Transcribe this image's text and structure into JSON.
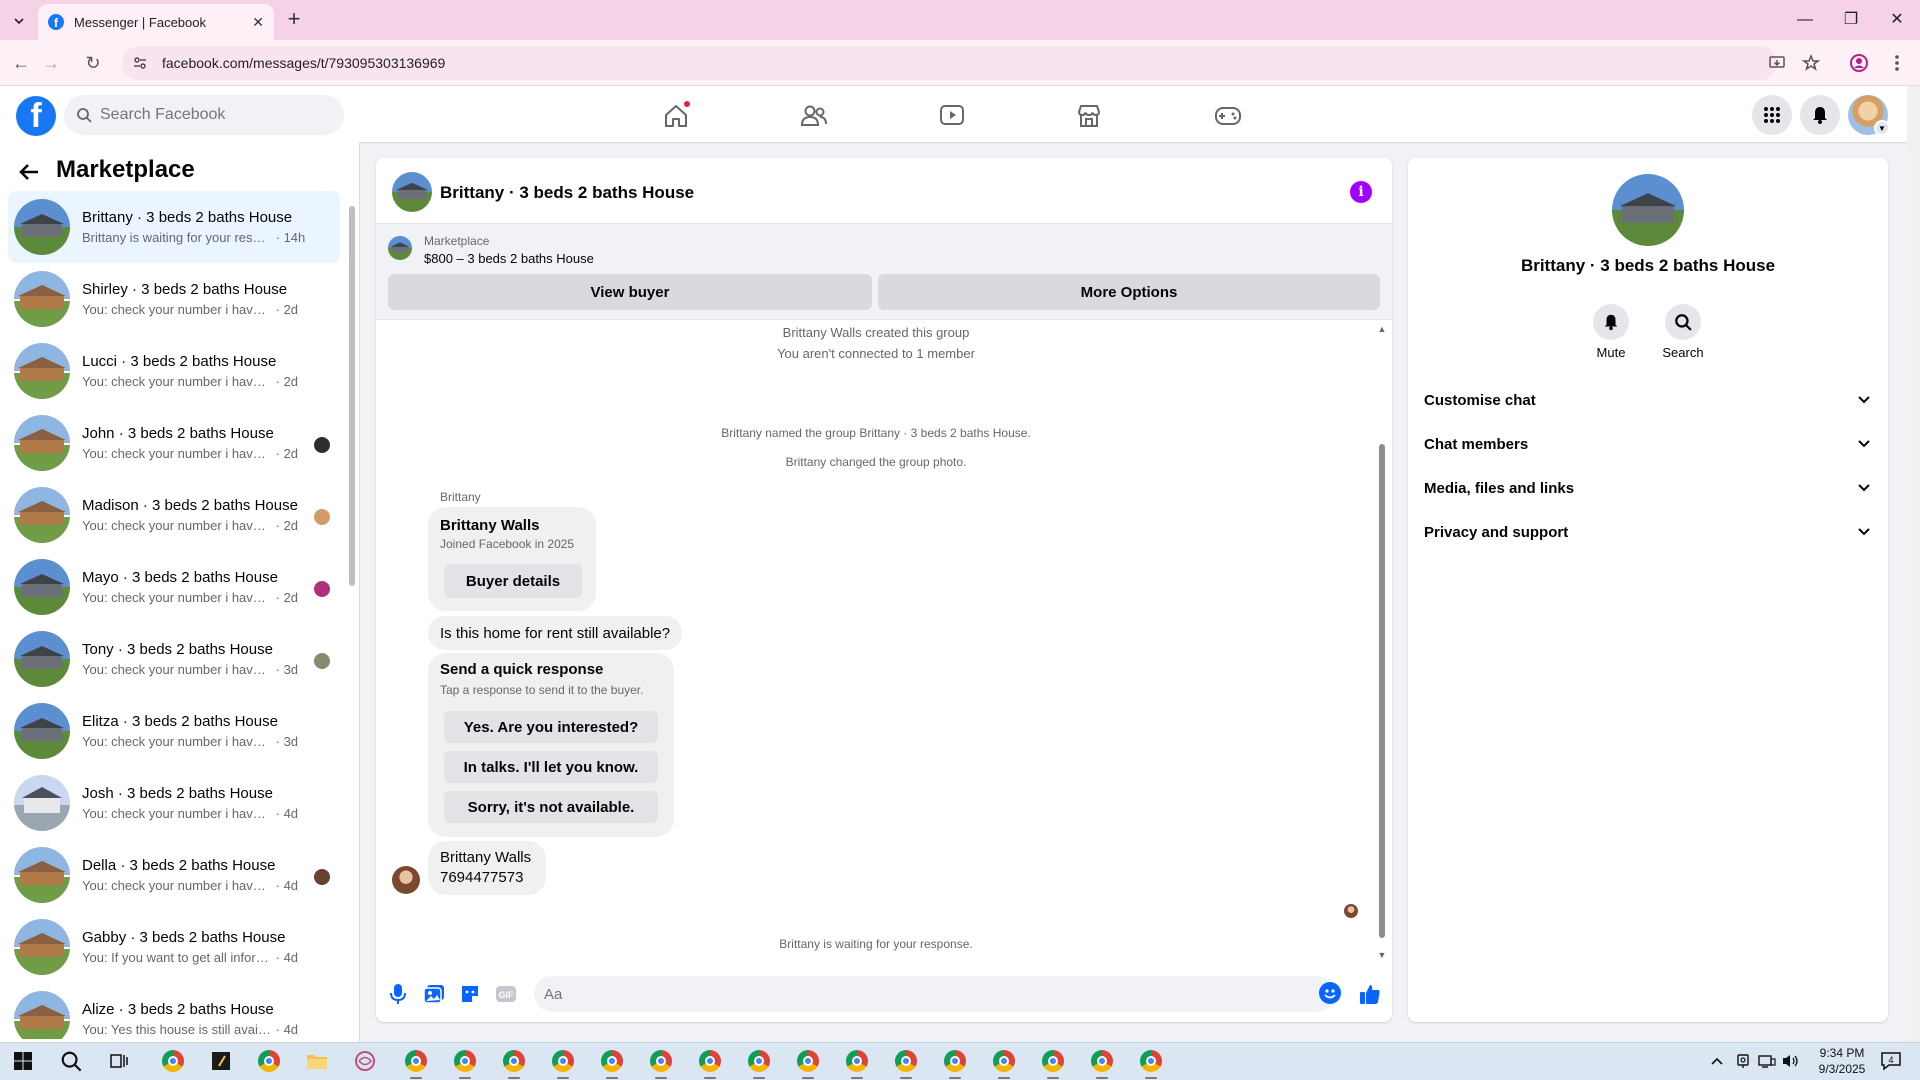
{
  "browser": {
    "tab_title": "Messenger | Facebook",
    "url": "facebook.com/messages/t/793095303136969"
  },
  "fb": {
    "search_placeholder": "Search Facebook"
  },
  "left": {
    "title": "Marketplace",
    "conversations": [
      {
        "name": "Brittany · 3 beds 2 baths House",
        "preview": "Brittany is waiting for your respon...",
        "time": "· 14h",
        "active": true
      },
      {
        "name": "Shirley · 3 beds 2 baths House",
        "preview": "You: check your number i have sen...",
        "time": "· 2d"
      },
      {
        "name": "Lucci · 3 beds 2 baths House",
        "preview": "You: check your number i have sen...",
        "time": "· 2d"
      },
      {
        "name": "John · 3 beds 2 baths House",
        "preview": "You: check your number i have s...",
        "time": "· 2d"
      },
      {
        "name": "Madison · 3 beds 2 baths House",
        "preview": "You: check your number i have s...",
        "time": "· 2d"
      },
      {
        "name": "Mayo · 3 beds 2 baths House",
        "preview": "You: check your number i have s...",
        "time": "· 2d"
      },
      {
        "name": "Tony · 3 beds 2 baths House",
        "preview": "You: check your number i have s...",
        "time": "· 3d"
      },
      {
        "name": "Elitza · 3 beds 2 baths House",
        "preview": "You: check your number i have sen...",
        "time": "· 3d"
      },
      {
        "name": "Josh · 3 beds 2 baths House",
        "preview": "You: check your number i have sen...",
        "time": "· 4d"
      },
      {
        "name": "Della · 3 beds 2 baths House",
        "preview": "You: check your number i have s...",
        "time": "· 4d"
      },
      {
        "name": "Gabby · 3 beds 2 baths House",
        "preview": "You: If you want to get all informati...",
        "time": "· 4d"
      },
      {
        "name": "Alize · 3 beds 2 baths House",
        "preview": "You: Yes this house is still available ...",
        "time": "· 4d"
      }
    ]
  },
  "chat": {
    "title": "Brittany · 3 beds 2 baths House",
    "listing_category": "Marketplace",
    "listing_price": "$800 – 3 beds 2 baths House",
    "view_buyer": "View buyer",
    "more_options": "More Options",
    "sys_created": "Brittany Walls created this group",
    "sys_not_connected": "You aren't connected to 1 member",
    "sys_named": "Brittany named the group Brittany · 3 beds 2 baths House.",
    "sys_photo": "Brittany changed the group photo.",
    "sender_label": "Brittany",
    "buyer_name": "Brittany Walls",
    "buyer_joined": "Joined Facebook in 2025",
    "buyer_details": "Buyer details",
    "question": "Is this home for rent still available?",
    "quick_title": "Send a quick response",
    "quick_sub": "Tap a response to send it to the buyer.",
    "quick_1": "Yes. Are you interested?",
    "quick_2": "In talks. I'll let you know.",
    "quick_3": "Sorry, it's not available.",
    "contact_name": "Brittany Walls",
    "contact_number": "7694477573",
    "waiting": "Brittany is waiting for your response.",
    "input_placeholder": "Aa"
  },
  "right": {
    "title": "Brittany · 3 beds 2 baths House",
    "mute": "Mute",
    "search": "Search",
    "sections": [
      "Customise chat",
      "Chat members",
      "Media, files and links",
      "Privacy and support"
    ]
  },
  "taskbar": {
    "time": "9:34 PM",
    "date": "9/3/2025",
    "notifications": "4"
  },
  "colors": {
    "brand": "#1877f2",
    "messenger_blue": "#0866ff",
    "info_purple": "#a100ff",
    "tab_bar": "#f6d2e6"
  }
}
